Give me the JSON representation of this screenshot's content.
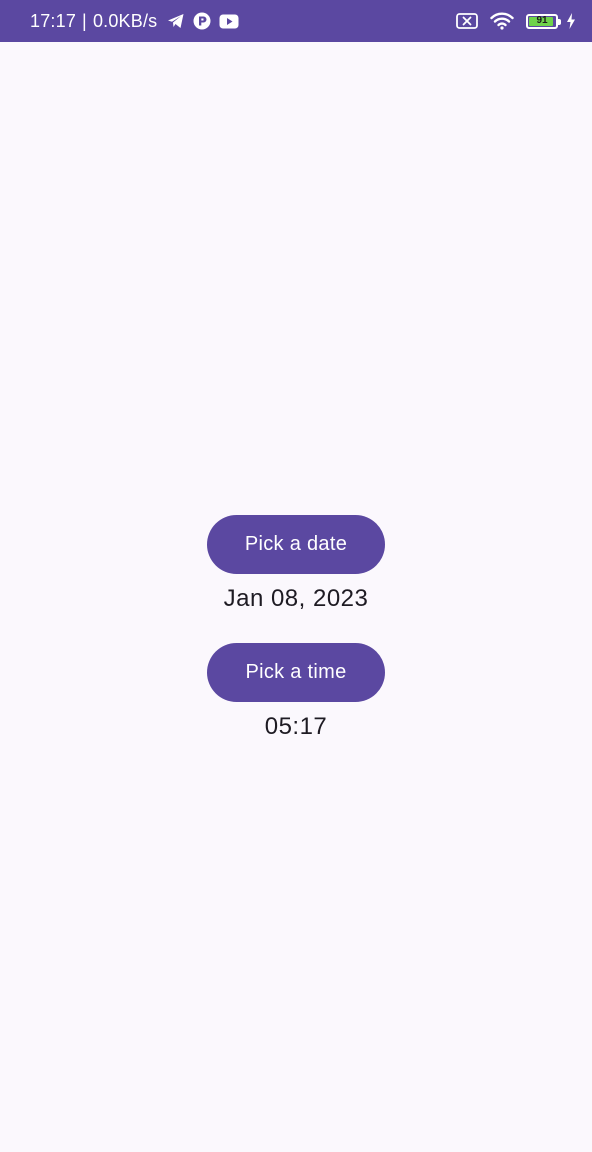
{
  "status_bar": {
    "time": "17:17",
    "separator": "|",
    "network_speed": "0.0KB/s",
    "left_icons": [
      "telegram-icon",
      "app-notification-icon",
      "youtube-icon"
    ],
    "right_icons": [
      "sim-crossed-icon",
      "wifi-icon",
      "battery-icon",
      "charging-icon"
    ],
    "battery_level": "91",
    "battery_fraction": 0.91,
    "background_color": "#5b48a1"
  },
  "main": {
    "date_button_label": "Pick a date",
    "date_value": "Jan 08, 2023",
    "time_button_label": "Pick a time",
    "time_value": "05:17"
  },
  "colors": {
    "accent": "#5b48a1",
    "background": "#fbf8fd",
    "text": "#1e1b23",
    "battery_fill": "#6fd34a"
  }
}
